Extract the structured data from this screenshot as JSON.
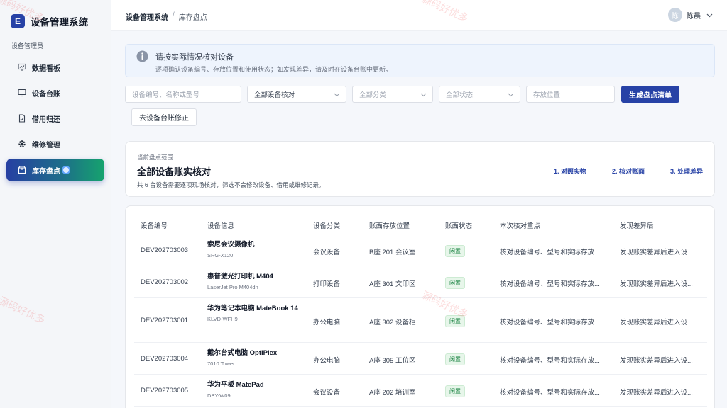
{
  "app": {
    "logo_letter": "E",
    "title": "设备管理系统",
    "role": "设备管理员"
  },
  "sidebar": {
    "items": [
      {
        "label": "数据看板",
        "icon": "dashboard-icon"
      },
      {
        "label": "设备台账",
        "icon": "monitor-icon"
      },
      {
        "label": "借用归还",
        "icon": "document-icon"
      },
      {
        "label": "维修管理",
        "icon": "gear-icon"
      },
      {
        "label": "库存盘点",
        "icon": "box-icon",
        "active": true
      }
    ]
  },
  "header": {
    "breadcrumb": [
      "设备管理系统",
      "库存盘点"
    ],
    "separator": "/",
    "user": {
      "avatar_char": "陈",
      "name": "陈晨"
    }
  },
  "alert": {
    "title": "请按实际情况核对设备",
    "text": "逐项确认设备编号、存放位置和使用状态；如发现差异，请及时在设备台账中更新。"
  },
  "filters": {
    "search_placeholder": "设备编号、名称或型号",
    "check_select": "全部设备核对",
    "category_select": "全部分类",
    "status_select": "全部状态",
    "location_placeholder": "存放位置",
    "generate_button": "生成盘点清单",
    "fix_button": "去设备台账修正"
  },
  "scope": {
    "label": "当前盘点范围",
    "title": "全部设备账实核对",
    "desc": "共 6 台设备需要逐项现场核对，筛选不会修改设备、借用或维修记录。",
    "steps": [
      "1. 对照实物",
      "2. 核对账面",
      "3. 处理差异"
    ]
  },
  "table": {
    "headers": [
      "设备编号",
      "设备信息",
      "设备分类",
      "账面存放位置",
      "账面状态",
      "本次核对重点",
      "发现差异后"
    ],
    "rows": [
      {
        "id": "DEV202703003",
        "name": "索尼会议摄像机",
        "model": "SRG-X120",
        "category": "会议设备",
        "location": "B座 201 会议室",
        "status": "闲置",
        "focus": "核对设备编号、型号和实际存放...",
        "after": "发现账实差异后进入设..."
      },
      {
        "id": "DEV202703002",
        "name": "惠普激光打印机 M404",
        "model": "LaserJet Pro M404dn",
        "category": "打印设备",
        "location": "A座 301 文印区",
        "status": "闲置",
        "focus": "核对设备编号、型号和实际存放...",
        "after": "发现账实差异后进入设..."
      },
      {
        "id": "DEV202703001",
        "name": "华为笔记本电脑 MateBook 14",
        "model": "KLVD-WFH9",
        "category": "办公电脑",
        "location": "A座 302 设备柜",
        "status": "闲置",
        "focus": "核对设备编号、型号和实际存放...",
        "after": "发现账实差异后进入设..."
      },
      {
        "id": "DEV202703004",
        "name": "戴尔台式电脑 OptiPlex",
        "model": "7010 Tower",
        "category": "办公电脑",
        "location": "A座 305 工位区",
        "status": "闲置",
        "focus": "核对设备编号、型号和实际存放...",
        "after": "发现账实差异后进入设..."
      },
      {
        "id": "DEV202703005",
        "name": "华为平板 MatePad",
        "model": "DBY-W09",
        "category": "会议设备",
        "location": "A座 202 培训室",
        "status": "闲置",
        "focus": "核对设备编号、型号和实际存放...",
        "after": "发现账实差异后进入设..."
      }
    ]
  },
  "watermark": "源码好优多"
}
